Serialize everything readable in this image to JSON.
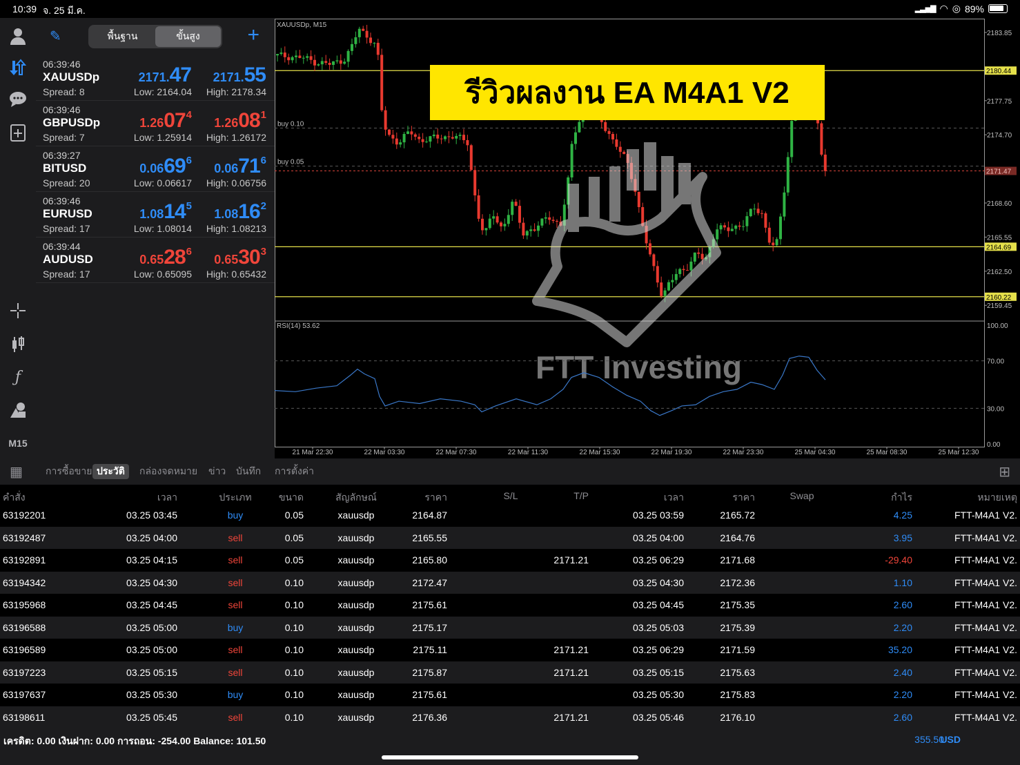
{
  "status": {
    "time": "10:39",
    "date": "จ. 25 มี.ค.",
    "battery": "89%"
  },
  "quotes_header": {
    "seg_basic": "พื้นฐาน",
    "seg_advanced": "ขั้นสูง"
  },
  "quotes": [
    {
      "time": "06:39:46",
      "symbol": "XAUUSDp",
      "spread": "Spread: 8",
      "bid_small": "2171.",
      "bid_big": "47",
      "bid_sup": "",
      "ask_small": "2171.",
      "ask_big": "55",
      "ask_sup": "",
      "bid_color": "blue",
      "ask_color": "blue",
      "low": "Low: 2164.04",
      "high": "High: 2178.34"
    },
    {
      "time": "06:39:46",
      "symbol": "GBPUSDp",
      "spread": "Spread: 7",
      "bid_small": "1.26",
      "bid_big": "07",
      "bid_sup": "4",
      "ask_small": "1.26",
      "ask_big": "08",
      "ask_sup": "1",
      "bid_color": "red",
      "ask_color": "red",
      "low": "Low: 1.25914",
      "high": "High: 1.26172"
    },
    {
      "time": "06:39:27",
      "symbol": "BITUSD",
      "spread": "Spread: 20",
      "bid_small": "0.06",
      "bid_big": "69",
      "bid_sup": "6",
      "ask_small": "0.06",
      "ask_big": "71",
      "ask_sup": "6",
      "bid_color": "blue",
      "ask_color": "blue",
      "low": "Low: 0.06617",
      "high": "High: 0.06756"
    },
    {
      "time": "06:39:46",
      "symbol": "EURUSD",
      "spread": "Spread: 17",
      "bid_small": "1.08",
      "bid_big": "14",
      "bid_sup": "5",
      "ask_small": "1.08",
      "ask_big": "16",
      "ask_sup": "2",
      "bid_color": "blue",
      "ask_color": "blue",
      "low": "Low: 1.08014",
      "high": "High: 1.08213"
    },
    {
      "time": "06:39:44",
      "symbol": "AUDUSD",
      "spread": "Spread: 17",
      "bid_small": "0.65",
      "bid_big": "28",
      "bid_sup": "6",
      "ask_small": "0.65",
      "ask_big": "30",
      "ask_sup": "3",
      "bid_color": "red",
      "ask_color": "red",
      "low": "Low: 0.65095",
      "high": "High: 0.65432"
    }
  ],
  "tool_m15": "M15",
  "chart": {
    "symbol_label": "XAUUSDp, M15",
    "banner": "รีวิวผลงาน EA M4A1 V2",
    "watermark": "FTT Investing",
    "buy1": "buy 0.10",
    "buy2": "buy 0.05",
    "rsi_label": "RSI(14) 53.62",
    "price_ticks": [
      "2183.85",
      "2177.75",
      "2174.70",
      "2168.60",
      "2165.55",
      "2162.50",
      "2159.45"
    ],
    "price_tags": [
      "2180.44",
      "2171.47",
      "2164.69",
      "2160.22"
    ],
    "rsi_ticks": [
      "100.00",
      "70.00",
      "30.00",
      "0.00"
    ],
    "time_ticks": [
      "21 Mar 22:30",
      "22 Mar 03:30",
      "22 Mar 07:30",
      "22 Mar 11:30",
      "22 Mar 15:30",
      "22 Mar 19:30",
      "22 Mar 23:30",
      "25 Mar 04:30",
      "25 Mar 08:30",
      "25 Mar 12:30"
    ],
    "colors": {
      "up": "#2fb344",
      "down": "#e8392f",
      "level": "#e5e04a",
      "current": "#d9453a",
      "rsi": "#3a78c9"
    }
  },
  "tabs": [
    "การซื้อขาย",
    "ประวัติ",
    "กล่องจดหมาย",
    "ข่าว",
    "บันทึก",
    "การตั้งค่า"
  ],
  "columns": [
    "คำสั่ง",
    "เวลา",
    "ประเภท",
    "ขนาด",
    "สัญลักษณ์",
    "ราคา",
    "S/L",
    "T/P",
    "เวลา",
    "ราคา",
    "Swap",
    "กำไร",
    "หมายเหตุ"
  ],
  "orders": [
    {
      "id": "63192201",
      "time": "03.25 03:45",
      "type": "buy",
      "size": "0.05",
      "symbol": "xauusdp",
      "price": "2164.87",
      "sl": "",
      "tp": "",
      "ctime": "03.25 03:59",
      "cprice": "2165.72",
      "swap": "",
      "profit": "4.25",
      "note": "FTT-M4A1 V2."
    },
    {
      "id": "63192487",
      "time": "03.25 04:00",
      "type": "sell",
      "size": "0.05",
      "symbol": "xauusdp",
      "price": "2165.55",
      "sl": "",
      "tp": "",
      "ctime": "03.25 04:00",
      "cprice": "2164.76",
      "swap": "",
      "profit": "3.95",
      "note": "FTT-M4A1 V2."
    },
    {
      "id": "63192891",
      "time": "03.25 04:15",
      "type": "sell",
      "size": "0.05",
      "symbol": "xauusdp",
      "price": "2165.80",
      "sl": "",
      "tp": "2171.21",
      "ctime": "03.25 06:29",
      "cprice": "2171.68",
      "swap": "",
      "profit": "-29.40",
      "note": "FTT-M4A1 V2."
    },
    {
      "id": "63194342",
      "time": "03.25 04:30",
      "type": "sell",
      "size": "0.10",
      "symbol": "xauusdp",
      "price": "2172.47",
      "sl": "",
      "tp": "",
      "ctime": "03.25 04:30",
      "cprice": "2172.36",
      "swap": "",
      "profit": "1.10",
      "note": "FTT-M4A1 V2."
    },
    {
      "id": "63195968",
      "time": "03.25 04:45",
      "type": "sell",
      "size": "0.10",
      "symbol": "xauusdp",
      "price": "2175.61",
      "sl": "",
      "tp": "",
      "ctime": "03.25 04:45",
      "cprice": "2175.35",
      "swap": "",
      "profit": "2.60",
      "note": "FTT-M4A1 V2."
    },
    {
      "id": "63196588",
      "time": "03.25 05:00",
      "type": "buy",
      "size": "0.10",
      "symbol": "xauusdp",
      "price": "2175.17",
      "sl": "",
      "tp": "",
      "ctime": "03.25 05:03",
      "cprice": "2175.39",
      "swap": "",
      "profit": "2.20",
      "note": "FTT-M4A1 V2."
    },
    {
      "id": "63196589",
      "time": "03.25 05:00",
      "type": "sell",
      "size": "0.10",
      "symbol": "xauusdp",
      "price": "2175.11",
      "sl": "",
      "tp": "2171.21",
      "ctime": "03.25 06:29",
      "cprice": "2171.59",
      "swap": "",
      "profit": "35.20",
      "note": "FTT-M4A1 V2."
    },
    {
      "id": "63197223",
      "time": "03.25 05:15",
      "type": "sell",
      "size": "0.10",
      "symbol": "xauusdp",
      "price": "2175.87",
      "sl": "",
      "tp": "2171.21",
      "ctime": "03.25 05:15",
      "cprice": "2175.63",
      "swap": "",
      "profit": "2.40",
      "note": "FTT-M4A1 V2."
    },
    {
      "id": "63197637",
      "time": "03.25 05:30",
      "type": "buy",
      "size": "0.10",
      "symbol": "xauusdp",
      "price": "2175.61",
      "sl": "",
      "tp": "",
      "ctime": "03.25 05:30",
      "cprice": "2175.83",
      "swap": "",
      "profit": "2.20",
      "note": "FTT-M4A1 V2."
    },
    {
      "id": "63198611",
      "time": "03.25 05:45",
      "type": "sell",
      "size": "0.10",
      "symbol": "xauusdp",
      "price": "2176.36",
      "sl": "",
      "tp": "2171.21",
      "ctime": "03.25 05:46",
      "cprice": "2176.10",
      "swap": "",
      "profit": "2.60",
      "note": "FTT-M4A1 V2."
    }
  ],
  "footer": {
    "summary": "เครดิต: 0.00 เงินฝาก: 0.00 การถอน: -254.00 Balance: 101.50",
    "total": "355.50",
    "currency": "USD"
  }
}
